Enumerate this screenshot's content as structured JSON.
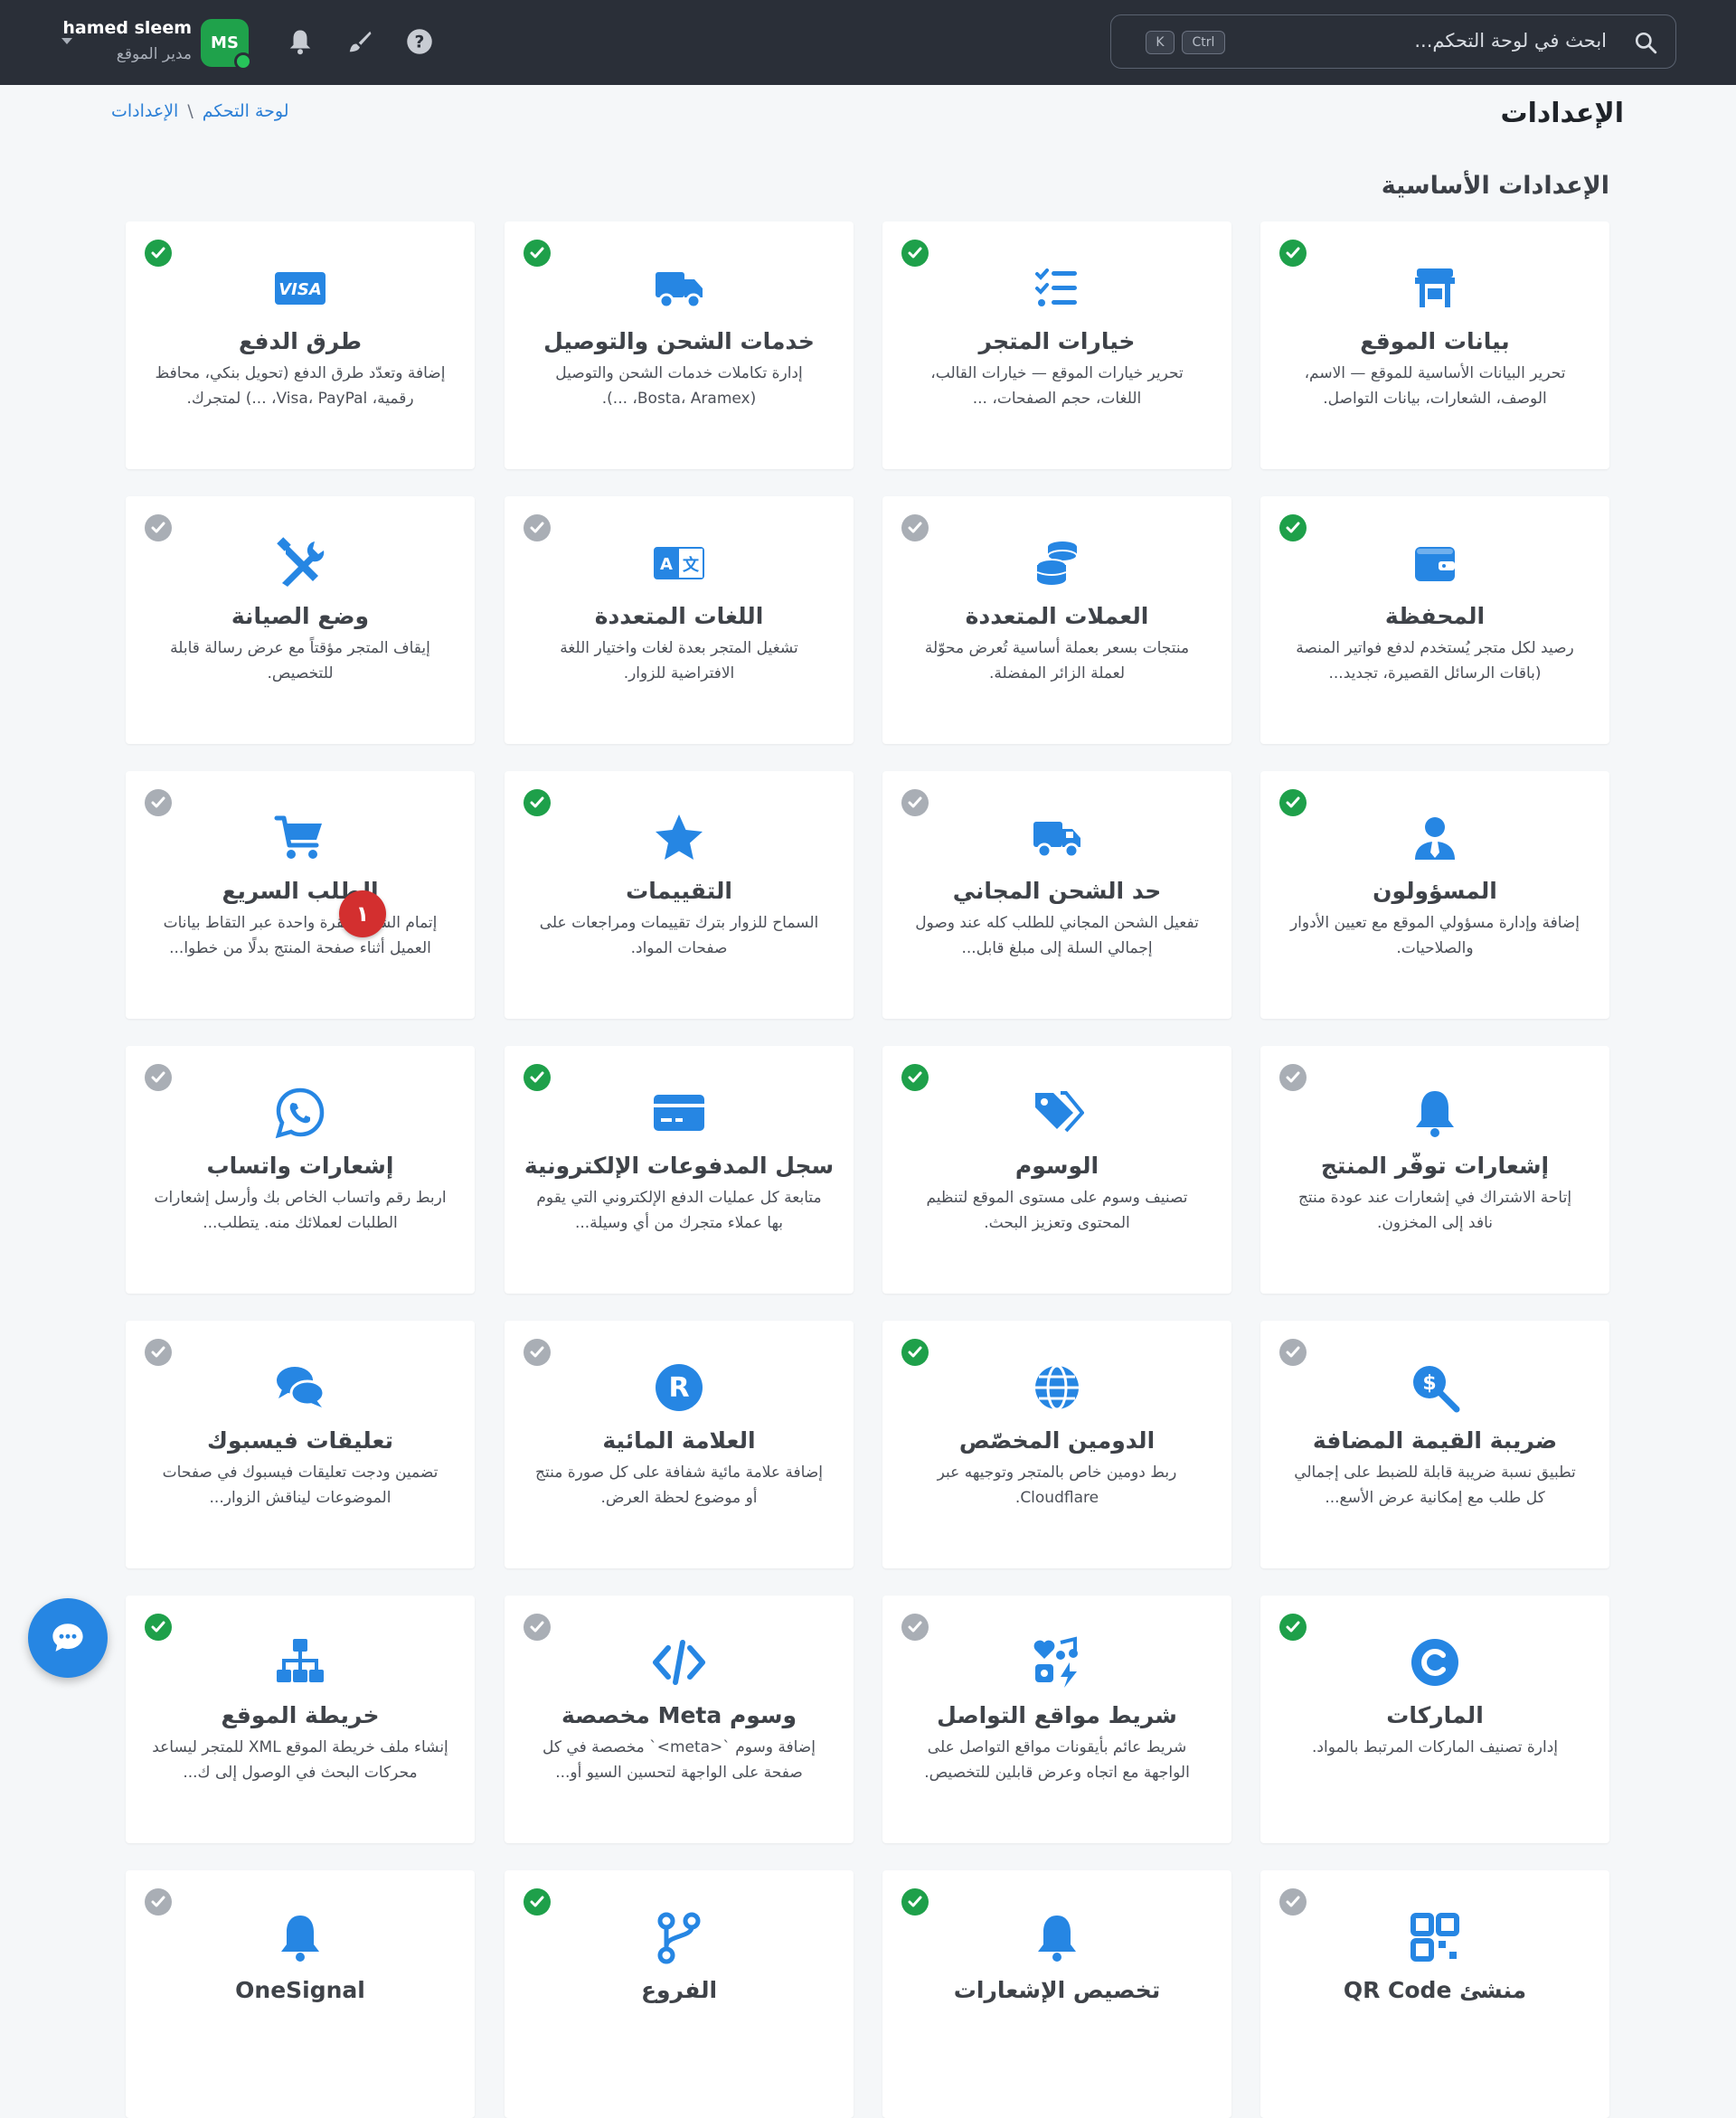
{
  "header": {
    "search_placeholder": "ابحث في لوحة التحكم...",
    "shortcut_ctrl": "Ctrl",
    "shortcut_k": "K",
    "user_name": "hamed sleem",
    "user_role": "مدير الموقع",
    "avatar_initials": "MS",
    "icons": [
      "help-icon",
      "brush-icon",
      "bell-icon"
    ]
  },
  "page": {
    "title": "الإعدادات",
    "breadcrumb": [
      "لوحة التحكم",
      "الإعدادات"
    ],
    "breadcrumb_sep": "\\"
  },
  "section": {
    "title": "الإعدادات الأساسية"
  },
  "cards": [
    {
      "title": "بيانات الموقع",
      "desc": "تحرير البيانات الأساسية للموقع — الاسم، الوصف، الشعارات، بيانات التواصل.",
      "icon": "store-icon",
      "enabled": true
    },
    {
      "title": "خيارات المتجر",
      "desc": "تحرير خيارات الموقع — خيارات القالب، اللغات، حجم الصفحات، ...",
      "icon": "list-check-icon",
      "enabled": true
    },
    {
      "title": "خدمات الشحن والتوصيل",
      "desc": "إدارة تكاملات خدمات الشحن والتوصيل (Bosta، Aramex، ...).",
      "icon": "truck-icon",
      "enabled": true
    },
    {
      "title": "طرق الدفع",
      "desc": "إضافة وتعدّد طرق الدفع (تحويل بنكي، محافظ رقمية، Visa، PayPal، ...) لمتجرك.",
      "icon": "visa-icon",
      "enabled": true
    },
    {
      "title": "المحفظة",
      "desc": "رصيد لكل متجر يُستخدم لدفع فواتير المنصة (باقات الرسائل القصيرة، تجديد...",
      "icon": "wallet-icon",
      "enabled": true
    },
    {
      "title": "العملات المتعددة",
      "desc": "منتجات بسعر بعملة أساسية تُعرض محوّلة لعملة الزائر المفضلة.",
      "icon": "coins-icon",
      "enabled": false
    },
    {
      "title": "اللغات المتعددة",
      "desc": "تشغيل المتجر بعدة لغات واختيار اللغة الافتراضية للزوار.",
      "icon": "language-icon",
      "enabled": false
    },
    {
      "title": "وضع الصيانة",
      "desc": "إيقاف المتجر مؤقتاً مع عرض رسالة قابلة للتخصيص.",
      "icon": "tools-icon",
      "enabled": false
    },
    {
      "title": "المسؤولون",
      "desc": "إضافة وإدارة مسؤولي الموقع مع تعيين الأدوار والصلاحيات.",
      "icon": "user-tie-icon",
      "enabled": true
    },
    {
      "title": "حد الشحن المجاني",
      "desc": "تفعيل الشحن المجاني للطلب كله عند وصول إجمالي السلة إلى مبلغ قابل...",
      "icon": "truck-fast-icon",
      "enabled": false
    },
    {
      "title": "التقييمات",
      "desc": "السماح للزوار بترك تقييمات ومراجعات على صفحات المواد.",
      "icon": "star-icon",
      "enabled": true
    },
    {
      "title": "الطلب السريع",
      "desc": "إتمام الشراء بنقرة واحدة عبر التقاط بيانات العميل أثناء صفحة المنتج بدلًا من خطوا...",
      "icon": "cart-icon",
      "enabled": false,
      "badge": "١"
    },
    {
      "title": "إشعارات توفّر المنتج",
      "desc": "إتاحة الاشتراك في إشعارات عند عودة منتج نافد إلى المخزون.",
      "icon": "bell-icon",
      "enabled": false
    },
    {
      "title": "الوسوم",
      "desc": "تصنيف وسوم على مستوى الموقع لتنظيم المحتوى وتعزيز البحث.",
      "icon": "tags-icon",
      "enabled": true
    },
    {
      "title": "سجل المدفوعات الإلكترونية",
      "desc": "متابعة كل عمليات الدفع الإلكتروني التي يقوم بها عملاء متجرك من أي وسيلة...",
      "icon": "credit-card-icon",
      "enabled": true
    },
    {
      "title": "إشعارات واتساب",
      "desc": "اربط رقم واتساب الخاص بك وأرسل إشعارات الطلبات لعملائك منه. يتطلب...",
      "icon": "whatsapp-icon",
      "enabled": false
    },
    {
      "title": "ضريبة القيمة المضافة",
      "desc": "تطبيق نسبة ضريبة قابلة للضبط على إجمالي كل طلب مع إمكانية عرض الأسع...",
      "icon": "tax-search-icon",
      "enabled": false
    },
    {
      "title": "الدومين المخصّص",
      "desc": "ربط دومين خاص بالمتجر وتوجيهه عبر Cloudflare.",
      "icon": "globe-icon",
      "enabled": true
    },
    {
      "title": "العلامة المائية",
      "desc": "إضافة علامة مائية شفافة على كل صورة منتج أو موضوع لحظة العرض.",
      "icon": "registered-icon",
      "enabled": false
    },
    {
      "title": "تعليقات فيسبوك",
      "desc": "تضمين ودجت تعليقات فيسبوك في صفحات الموضوعات ليناقش الزوار...",
      "icon": "comments-icon",
      "enabled": false
    },
    {
      "title": "الماركات",
      "desc": "إدارة تصنيف الماركات المرتبط بالمواد.",
      "icon": "copyright-icon",
      "enabled": true
    },
    {
      "title": "شريط مواقع التواصل",
      "desc": "شريط عائم بأيقونات مواقع التواصل على الواجهة مع اتجاه وعرض قابلين للتخصيص.",
      "icon": "social-icon",
      "enabled": false
    },
    {
      "title": "وسوم Meta مخصصة",
      "desc": "إضافة وسوم `<meta>` مخصصة في كل صفحة على الواجهة لتحسين السيو أو...",
      "icon": "code-icon",
      "enabled": false
    },
    {
      "title": "خريطة الموقع",
      "desc": "إنشاء ملف خريطة الموقع XML للمتجر ليساعد محركات البحث في الوصول إلى ك...",
      "icon": "sitemap-icon",
      "enabled": true
    },
    {
      "title": "منشئ QR Code",
      "desc": "",
      "icon": "qrcode-icon",
      "enabled": false
    },
    {
      "title": "تخصيص الإشعارات",
      "desc": "",
      "icon": "bell-icon",
      "enabled": true
    },
    {
      "title": "الفروع",
      "desc": "",
      "icon": "branch-icon",
      "enabled": true
    },
    {
      "title": "OneSignal",
      "desc": "",
      "icon": "bell-icon",
      "enabled": false
    }
  ],
  "colors": {
    "accent": "#2686e3",
    "enabled": "#1ea04a",
    "disabled": "#a9aeb5",
    "topbar": "#2a2f38"
  },
  "fab": {
    "icon": "chat-icon"
  }
}
